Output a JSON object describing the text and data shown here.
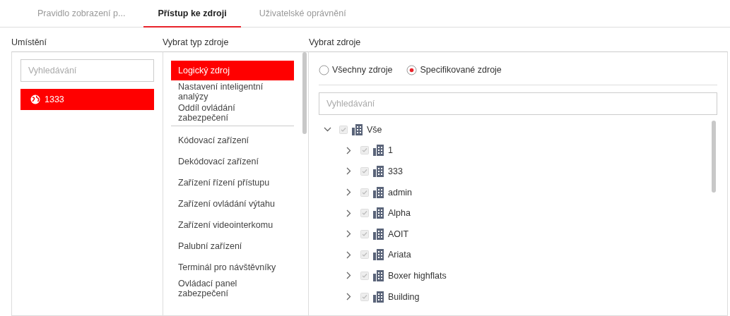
{
  "tabs": [
    {
      "label": "Pravidlo zobrazení p...",
      "selected": false
    },
    {
      "label": "Přístup ke zdroji",
      "selected": true
    },
    {
      "label": "Uživatelské oprávnění",
      "selected": false
    }
  ],
  "location": {
    "heading": "Umístění",
    "search": {
      "placeholder": "Vyhledávání"
    },
    "items": [
      {
        "label": "1333",
        "selected": true
      }
    ]
  },
  "resource_type": {
    "heading": "Vybrat typ zdroje",
    "groups": [
      [
        {
          "label": "Logický zdroj",
          "selected": true
        },
        {
          "label": "Nastavení inteligentní analýzy",
          "selected": false
        },
        {
          "label": "Oddíl ovládání zabezpečení",
          "selected": false
        }
      ],
      [
        {
          "label": "Kódovací zařízení",
          "selected": false
        },
        {
          "label": "Dekódovací zařízení",
          "selected": false
        },
        {
          "label": "Zařízení řízení přístupu",
          "selected": false
        },
        {
          "label": "Zařízení ovládání výtahu",
          "selected": false
        },
        {
          "label": "Zařízení videointerkomu",
          "selected": false
        },
        {
          "label": "Palubní zařízení",
          "selected": false
        },
        {
          "label": "Terminál pro návštěvníky",
          "selected": false
        },
        {
          "label": "Ovládací panel zabezpečení",
          "selected": false
        }
      ]
    ]
  },
  "resources": {
    "heading": "Vybrat zdroje",
    "scope": [
      {
        "label": "Všechny zdroje",
        "selected": false
      },
      {
        "label": "Specifikované zdroje",
        "selected": true
      }
    ],
    "search": {
      "placeholder": "Vyhledávání"
    },
    "tree": [
      {
        "label": "Vše",
        "expanded": true,
        "checked": true,
        "children": [
          {
            "label": "1",
            "expanded": false,
            "checked": true
          },
          {
            "label": "333",
            "expanded": false,
            "checked": true
          },
          {
            "label": "admin",
            "expanded": false,
            "checked": true
          },
          {
            "label": "Alpha",
            "expanded": false,
            "checked": true
          },
          {
            "label": "AOIT",
            "expanded": false,
            "checked": true
          },
          {
            "label": "Ariata",
            "expanded": false,
            "checked": true
          },
          {
            "label": "Boxer highflats",
            "expanded": false,
            "checked": true
          },
          {
            "label": "Building",
            "expanded": false,
            "checked": true
          }
        ]
      }
    ]
  }
}
